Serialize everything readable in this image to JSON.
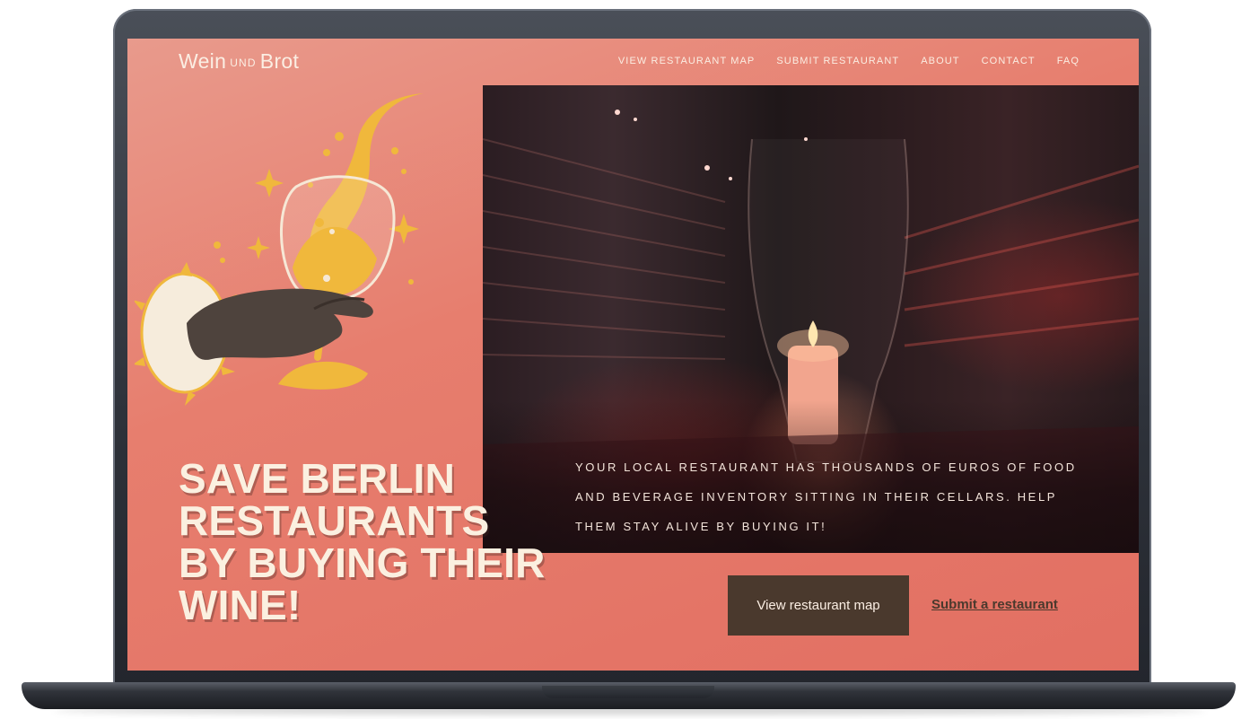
{
  "site": {
    "logo_left": "Wein",
    "logo_mid": "UND",
    "logo_right": "Brot"
  },
  "nav": {
    "items": [
      {
        "label": "VIEW RESTAURANT MAP"
      },
      {
        "label": "SUBMIT RESTAURANT"
      },
      {
        "label": "ABOUT"
      },
      {
        "label": "CONTACT"
      },
      {
        "label": "FAQ"
      }
    ]
  },
  "hero": {
    "headline_lines": [
      "SAVE BERLIN",
      "RESTAURANTS",
      "BY BUYING THEIR",
      "WINE!"
    ],
    "tagline": "YOUR LOCAL RESTAURANT HAS THOUSANDS OF EUROS OF FOOD AND BEVERAGE INVENTORY SITTING IN THEIR CELLARS. HELP THEM STAY ALIVE BY BUYING IT!",
    "primary_button": "View restaurant map",
    "secondary_link": "Submit a restaurant"
  },
  "colors": {
    "background": "#e77e6e",
    "text_light": "#fbeee3",
    "button_dark": "#4a392d",
    "illustration_yellow": "#f0b83c",
    "illustration_hand": "#4e433d"
  }
}
